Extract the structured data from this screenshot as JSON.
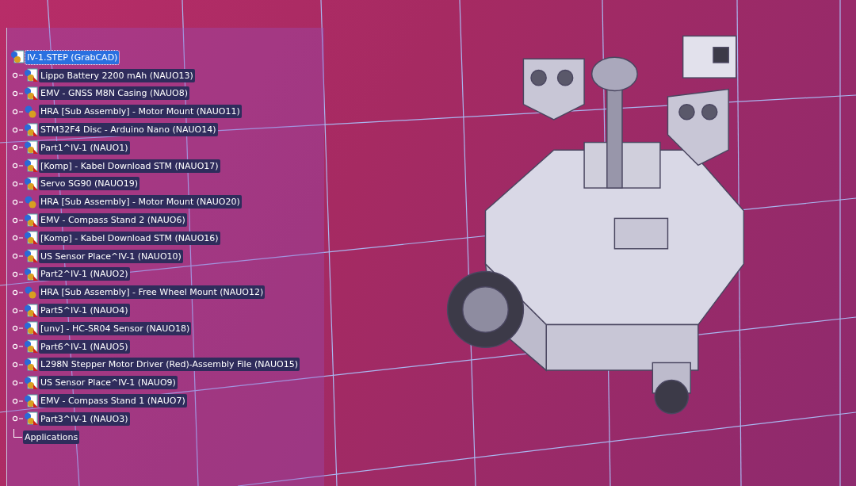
{
  "tree": {
    "root": {
      "label": "IV-1.STEP (GrabCAD)",
      "selected": true
    },
    "children": [
      {
        "label": "Lippo Battery 2200 mAh (NAUO13)",
        "kind": "part"
      },
      {
        "label": "EMV - GNSS M8N Casing (NAUO8)",
        "kind": "part"
      },
      {
        "label": "HRA [Sub Assembly] - Motor Mount (NAUO11)",
        "kind": "assembly"
      },
      {
        "label": "STM32F4 Disc - Arduino Nano (NAUO14)",
        "kind": "part"
      },
      {
        "label": "Part1^IV-1 (NAUO1)",
        "kind": "part"
      },
      {
        "label": "[Komp] - Kabel Download STM (NAUO17)",
        "kind": "part"
      },
      {
        "label": "Servo SG90 (NAUO19)",
        "kind": "part"
      },
      {
        "label": "HRA [Sub Assembly] - Motor Mount (NAUO20)",
        "kind": "assembly"
      },
      {
        "label": "EMV - Compass Stand 2 (NAUO6)",
        "kind": "part"
      },
      {
        "label": "[Komp] - Kabel Download STM (NAUO16)",
        "kind": "part"
      },
      {
        "label": "US Sensor Place^IV-1 (NAUO10)",
        "kind": "part"
      },
      {
        "label": "Part2^IV-1 (NAUO2)",
        "kind": "part"
      },
      {
        "label": "HRA [Sub Assembly] - Free Wheel Mount (NAUO12)",
        "kind": "assembly"
      },
      {
        "label": "Part5^IV-1 (NAUO4)",
        "kind": "part"
      },
      {
        "label": "[unv] - HC-SR04 Sensor (NAUO18)",
        "kind": "part"
      },
      {
        "label": "Part6^IV-1 (NAUO5)",
        "kind": "part"
      },
      {
        "label": "L298N Stepper Motor Driver (Red)-Assembly File (NAUO15)",
        "kind": "part"
      },
      {
        "label": "US Sensor Place^IV-1 (NAUO9)",
        "kind": "part"
      },
      {
        "label": "EMV - Compass Stand 1 (NAUO7)",
        "kind": "part"
      },
      {
        "label": "Part3^IV-1 (NAUO3)",
        "kind": "part"
      }
    ],
    "applications": {
      "label": "Applications"
    }
  }
}
